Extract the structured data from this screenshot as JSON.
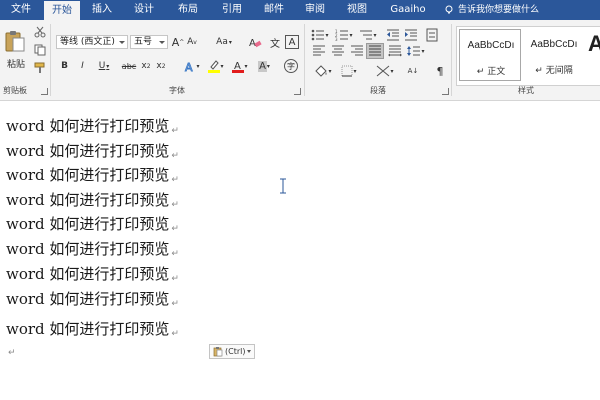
{
  "tabs": [
    {
      "label": "文件",
      "active": false
    },
    {
      "label": "开始",
      "active": true
    },
    {
      "label": "插入",
      "active": false
    },
    {
      "label": "设计",
      "active": false
    },
    {
      "label": "布局",
      "active": false
    },
    {
      "label": "引用",
      "active": false
    },
    {
      "label": "邮件",
      "active": false
    },
    {
      "label": "审阅",
      "active": false
    },
    {
      "label": "视图",
      "active": false
    },
    {
      "label": "Gaaiho",
      "active": false
    }
  ],
  "tell_me": {
    "placeholder": "告诉我你想要做什么",
    "icon": "lightbulb-icon"
  },
  "clipboard": {
    "paste_label": "粘贴",
    "group_label": "剪贴板"
  },
  "font": {
    "font_name": "等线 (西文正)",
    "font_size": "五号",
    "grow_label": "A",
    "shrink_label": "A",
    "case_label": "Aa",
    "phonetic_label": "文",
    "border_label": "A",
    "bold_label": "B",
    "italic_label": "I",
    "underline_label": "U",
    "strike_label": "abc",
    "subscript_label": "x",
    "superscript_label": "x",
    "color_label": "A",
    "shading_label": "A",
    "enclose_label": "字",
    "group_label": "字体"
  },
  "paragraph": {
    "group_label": "段落",
    "sort_label": "A↓",
    "show_marks_label": "¶"
  },
  "styles": {
    "group_label": "样式",
    "items": [
      {
        "sample": "AaBbCcDı",
        "name": "正文"
      },
      {
        "sample": "AaBbCcDı",
        "name": "无间隔"
      }
    ],
    "partial_sample": "A"
  },
  "document": {
    "lines": [
      "word 如何进行打印预览",
      "word 如何进行打印预览",
      "word 如何进行打印预览",
      "word 如何进行打印预览",
      "word 如何进行打印预览",
      "word 如何进行打印预览",
      "word 如何进行打印预览",
      "word 如何进行打印预览",
      "word 如何进行打印预览"
    ],
    "paragraph_mark": "↵",
    "paste_options_label": "(Ctrl)"
  },
  "colors": {
    "accent": "#2b579a",
    "font_color_bar": "#e11c1c",
    "highlight_bar": "#ffff00",
    "ribbon_bg": "#f3f3f3"
  }
}
